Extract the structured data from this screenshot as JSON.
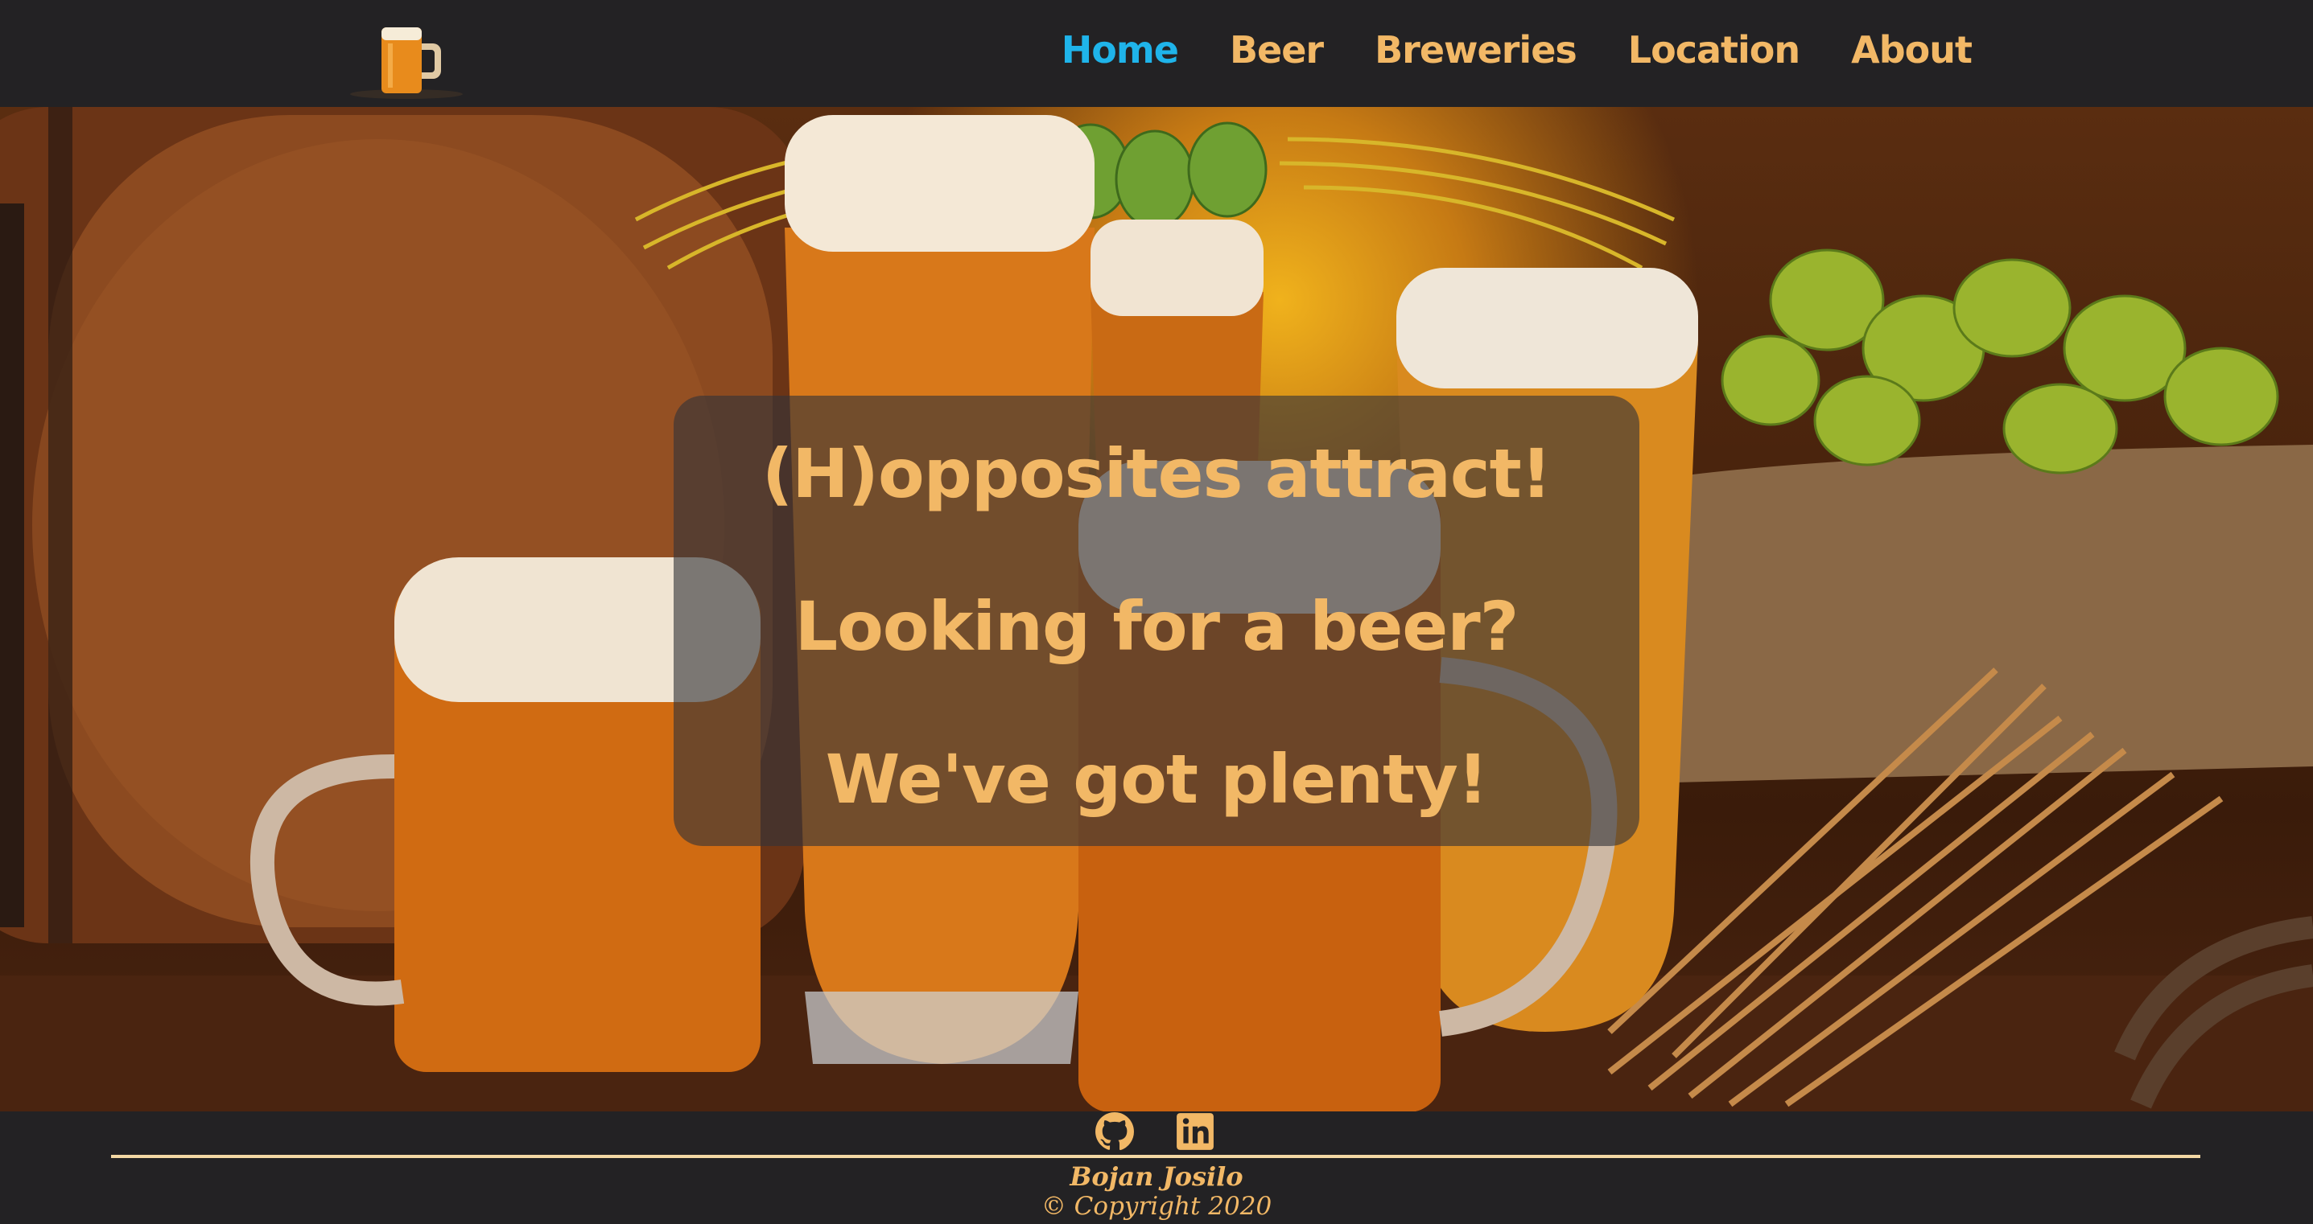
{
  "nav": {
    "logo_icon": "beer-mug-icon",
    "links": [
      {
        "label": "Home",
        "active": true
      },
      {
        "label": "Beer",
        "active": false
      },
      {
        "label": "Breweries",
        "active": false
      },
      {
        "label": "Location",
        "active": false
      },
      {
        "label": "About",
        "active": false
      }
    ]
  },
  "hero": {
    "lines": [
      "(H)opposites attract!",
      "Looking for a beer?",
      "We've got plenty!"
    ]
  },
  "footer": {
    "icons": [
      "github-icon",
      "linkedin-icon"
    ],
    "name": "Bojan Josilo",
    "copyright": "© Copyright 2020"
  },
  "colors": {
    "accent": "#f2b866",
    "active_link": "#1fb4ea",
    "background": "#232224",
    "rule": "#f3d8a4"
  }
}
